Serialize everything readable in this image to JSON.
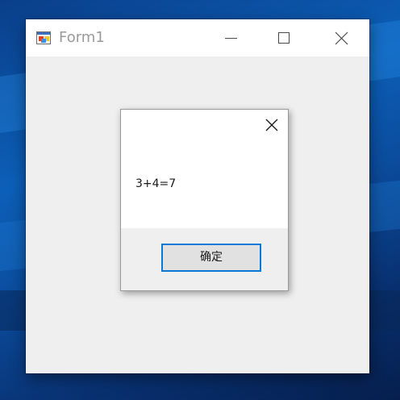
{
  "window": {
    "title": "Form1",
    "icon": "winforms-app-icon",
    "controls": {
      "minimize_icon": "minimize-icon",
      "maximize_icon": "maximize-icon",
      "close_icon": "close-icon"
    }
  },
  "dialog": {
    "message": "3+4=7",
    "ok_label": "确定",
    "close_icon": "close-icon"
  },
  "colors": {
    "accent": "#0a78d7",
    "window_bg": "#efefef",
    "titlebar_bg": "#ffffff",
    "title_text": "#9a9a9a"
  }
}
